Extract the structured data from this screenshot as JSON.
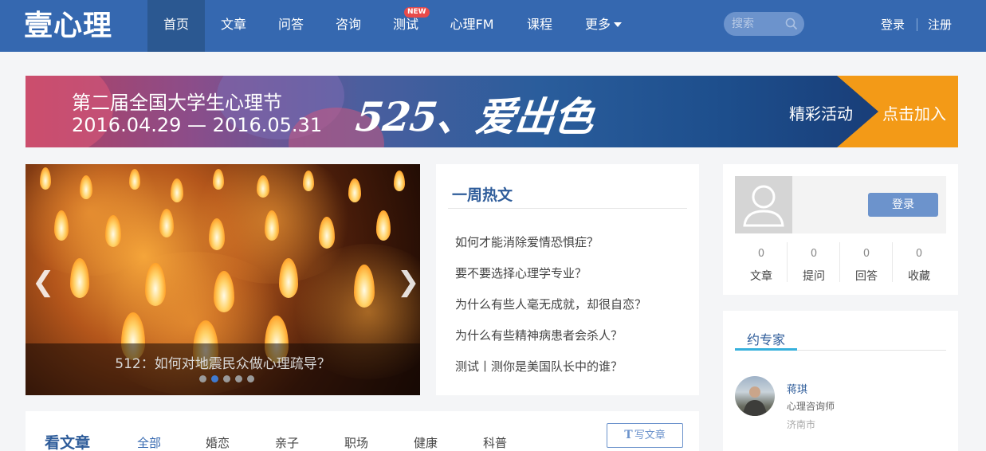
{
  "header": {
    "logo": "壹心理",
    "nav": [
      {
        "label": "首页",
        "active": true
      },
      {
        "label": "文章"
      },
      {
        "label": "问答"
      },
      {
        "label": "咨询"
      },
      {
        "label": "测试",
        "badge": "NEW"
      },
      {
        "label": "心理FM"
      },
      {
        "label": "课程"
      },
      {
        "label": "更多"
      }
    ],
    "search_placeholder": "搜索",
    "login": "登录",
    "register": "注册"
  },
  "banner": {
    "title": "第二届全国大学生心理节",
    "date": "2016.04.29 — 2016.05.31",
    "slogan": "525、爱出色",
    "activity": "精彩活动",
    "join": "点击加入"
  },
  "slider": {
    "caption": "512：如何对地震民众做心理疏导？",
    "prev": "❮",
    "next": "❯",
    "dot_count": 5,
    "active_dot": 1
  },
  "hot": {
    "title": "一周热文",
    "items": [
      "如何才能消除爱情恐惧症？",
      "要不要选择心理学专业？",
      "为什么有些人毫无成就，却很自恋？",
      "为什么有些精神病患者会杀人？",
      "测试丨测你是美国队长中的谁？"
    ]
  },
  "user": {
    "login": "登录",
    "stats": [
      {
        "num": "0",
        "label": "文章"
      },
      {
        "num": "0",
        "label": "提问"
      },
      {
        "num": "0",
        "label": "回答"
      },
      {
        "num": "0",
        "label": "收藏"
      }
    ]
  },
  "expert": {
    "title": "约专家",
    "name": "蒋琪",
    "role": "心理咨询师",
    "city": "济南市"
  },
  "articles": {
    "title": "看文章",
    "categories": [
      "全部",
      "婚恋",
      "亲子",
      "职场",
      "健康",
      "科普"
    ],
    "write_icon": "T",
    "write_label": "写文章"
  },
  "colors": {
    "header": "#3568b0",
    "accent_orange": "#f39a17",
    "button": "#6c93cc",
    "tab_underline": "#36b0dc"
  }
}
